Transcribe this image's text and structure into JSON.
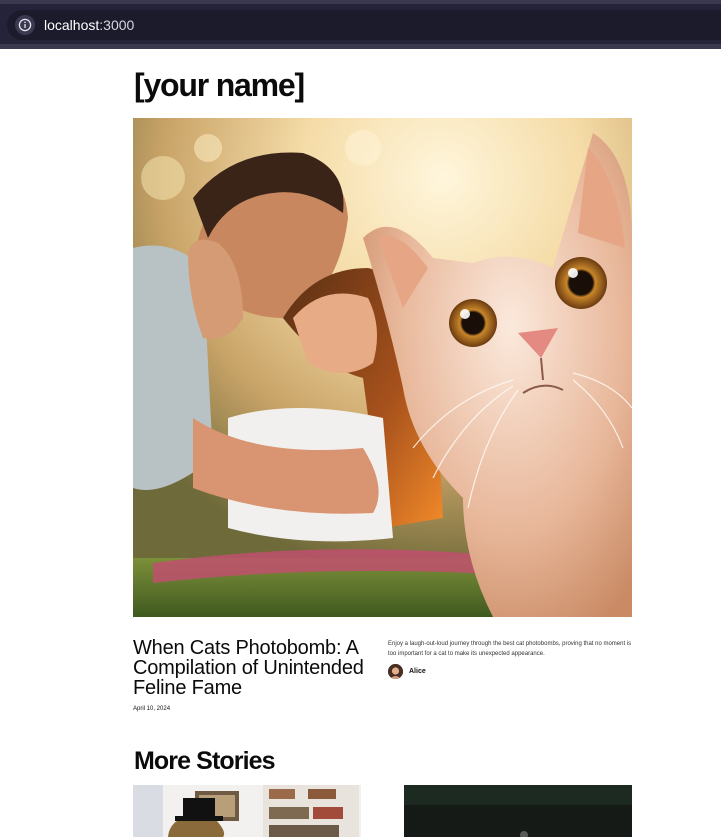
{
  "browser": {
    "url_host": "localhost",
    "url_port": ":3000"
  },
  "site": {
    "title": "[your name]"
  },
  "hero_post": {
    "image_alt": "Couple kissing with a cat photobombing",
    "title": "When Cats Photobomb: A Compilation of Unintended Feline Fame",
    "date": "April 10, 2024",
    "excerpt": "Enjoy a laugh-out-loud journey through the best cat photobombs, proving that no moment is too important for a cat to make its unexpected appearance.",
    "author": "Alice"
  },
  "more_stories": {
    "heading": "More Stories"
  },
  "icons": [
    "info-icon"
  ],
  "colors": {
    "chrome": "#25233a",
    "chrome_edge": "#3b3950",
    "text": "#0b0b0b"
  }
}
